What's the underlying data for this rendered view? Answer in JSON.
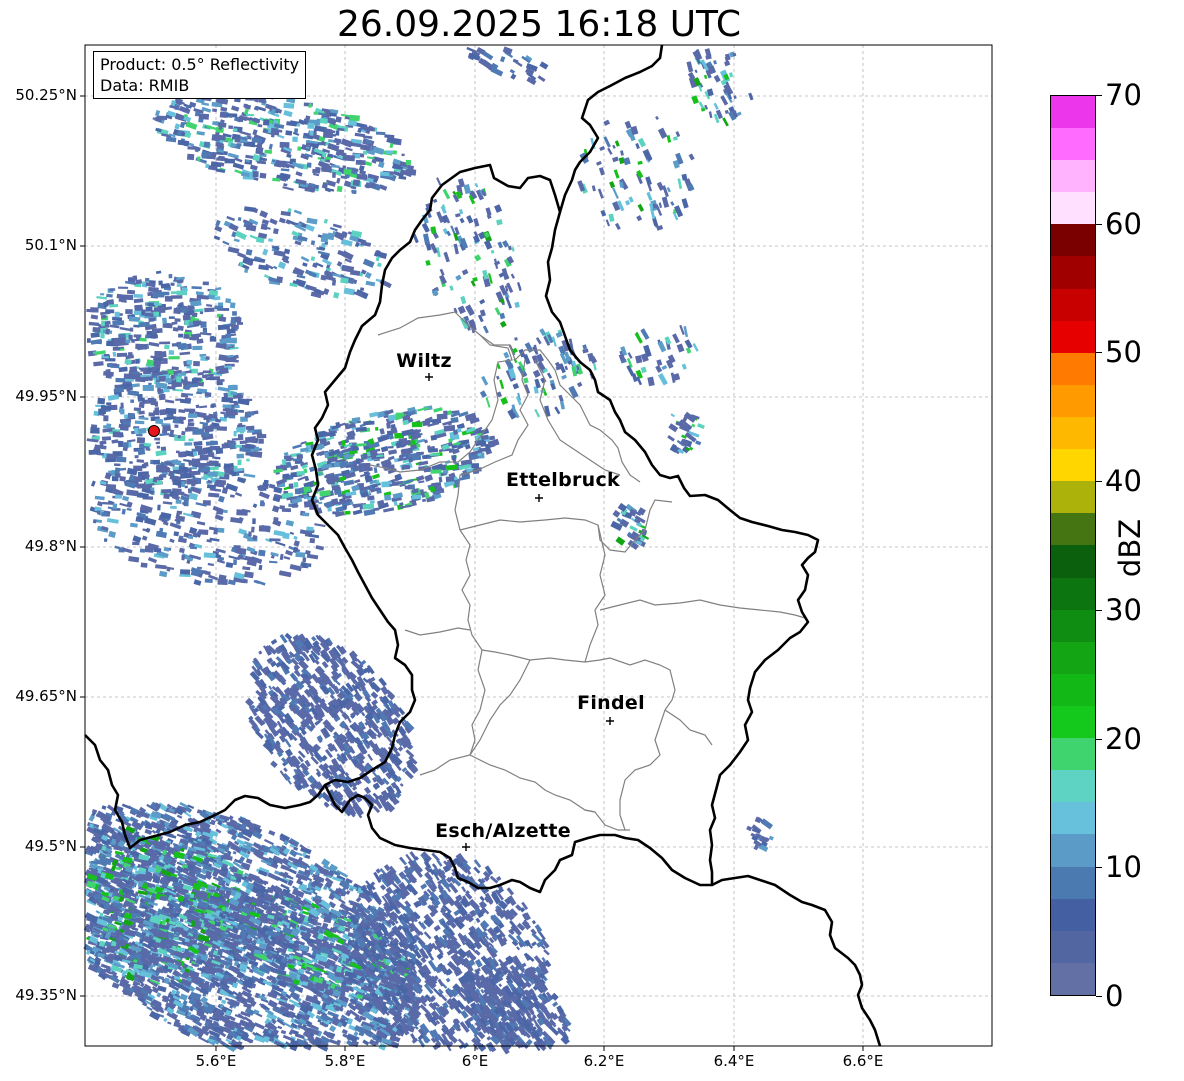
{
  "title": "26.09.2025 16:18 UTC",
  "info": {
    "product": "Product: 0.5° Reflectivity",
    "data": "Data: RMIB"
  },
  "axes": {
    "lat_labels": [
      "50.25°N",
      "50.1°N",
      "49.95°N",
      "49.8°N",
      "49.65°N",
      "49.5°N",
      "49.35°N"
    ],
    "lon_labels": [
      "5.6°E",
      "5.8°E",
      "6°E",
      "6.2°E",
      "6.4°E",
      "6.6°E"
    ]
  },
  "cities": [
    {
      "name": "Wiltz"
    },
    {
      "name": "Ettelbruck"
    },
    {
      "name": "Findel"
    },
    {
      "name": "Esch/Alzette"
    }
  ],
  "colorbar": {
    "label": "dBZ",
    "ticks": [
      "0",
      "10",
      "20",
      "30",
      "40",
      "50",
      "60",
      "70"
    ],
    "colors": [
      "#6270a6",
      "#5266a1",
      "#4560a2",
      "#4a7ab0",
      "#5a9cc7",
      "#67c1dd",
      "#5fd3c3",
      "#3fd46e",
      "#14c91c",
      "#12b816",
      "#13a514",
      "#0f8c12",
      "#0c7510",
      "#0a600d",
      "#457513",
      "#adb20a",
      "#ffd600",
      "#ffb800",
      "#ff9a00",
      "#ff7a00",
      "#e60000",
      "#c80000",
      "#a00000",
      "#7a0000",
      "#ffe1ff",
      "#ffb3ff",
      "#ff6bff",
      "#ec36ec"
    ]
  },
  "colors": {
    "border": "#000000",
    "district": "#808080",
    "grid": "#b0b0b0",
    "radar_site": "#e8161a"
  }
}
